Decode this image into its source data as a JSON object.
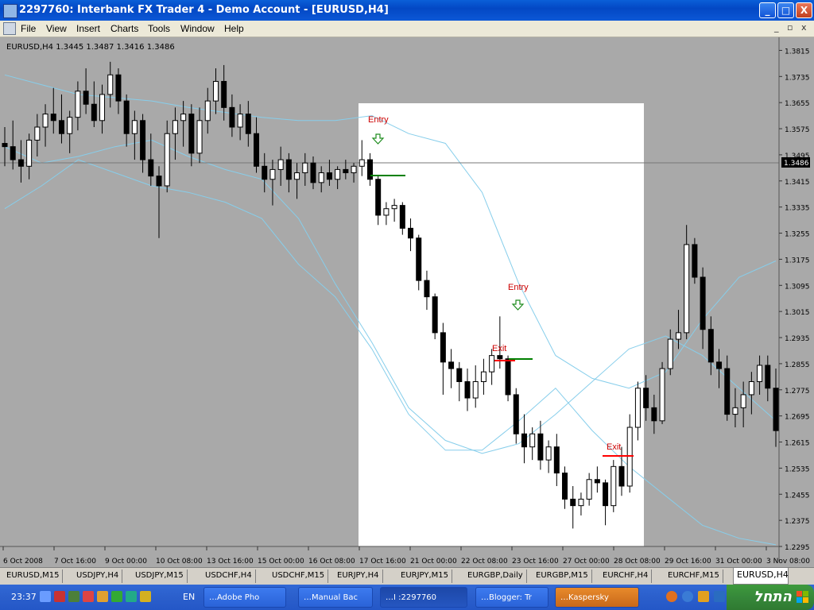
{
  "window": {
    "title": "2297760: Interbank FX Trader 4 - Demo Account - [EURUSD,H4]",
    "minimize": "_",
    "maximize": "□",
    "close": "X"
  },
  "menu": {
    "items": [
      "File",
      "View",
      "Insert",
      "Charts",
      "Tools",
      "Window",
      "Help"
    ],
    "mdi_controls": [
      "_",
      "▫",
      "x"
    ]
  },
  "chart": {
    "header": "EURUSD,H4  1.3445 1.3487 1.3416 1.3486",
    "current_price": "1.3486",
    "colors": {
      "background": "#a9a9a9",
      "panel": "#ffffff",
      "bands": "#87ceeb",
      "candle": "#000000",
      "entry_line": "#008000",
      "exit_line": "#ff0000",
      "annotation_text": "#cc0000",
      "arrow": "#1e8c1e"
    },
    "annotations": [
      {
        "text": "Entry"
      },
      {
        "text": "Entry"
      },
      {
        "text": "Exit"
      },
      {
        "text": "Exit"
      }
    ]
  },
  "chart_data": {
    "type": "candlestick",
    "symbol": "EURUSD",
    "timeframe": "H4",
    "ylim": [
      1.2295,
      1.3855
    ],
    "y_ticks": [
      "1.3815",
      "1.3735",
      "1.3655",
      "1.3575",
      "1.3495",
      "1.3415",
      "1.3335",
      "1.3255",
      "1.3175",
      "1.3095",
      "1.3015",
      "1.2935",
      "1.2855",
      "1.2775",
      "1.2695",
      "1.2615",
      "1.2535",
      "1.2455",
      "1.2375",
      "1.2295"
    ],
    "x_ticks": [
      "6 Oct 2008",
      "7 Oct 16:00",
      "9 Oct 00:00",
      "10 Oct 08:00",
      "13 Oct 16:00",
      "15 Oct 00:00",
      "16 Oct 08:00",
      "17 Oct 16:00",
      "21 Oct 00:00",
      "22 Oct 08:00",
      "23 Oct 16:00",
      "27 Oct 00:00",
      "28 Oct 08:00",
      "29 Oct 16:00",
      "31 Oct 00:00",
      "3 Nov 08:00"
    ],
    "last_price": 1.3486,
    "bollinger": {
      "upper": [
        1.374,
        1.371,
        1.368,
        1.367,
        1.366,
        1.364,
        1.3625,
        1.361,
        1.36,
        1.36,
        1.3615,
        1.356,
        1.353,
        1.338,
        1.31,
        1.288,
        1.281,
        1.278,
        1.283,
        1.299,
        1.312,
        1.317
      ],
      "middle": [
        1.352,
        1.347,
        1.349,
        1.352,
        1.354,
        1.349,
        1.345,
        1.342,
        1.33,
        1.31,
        1.292,
        1.272,
        1.262,
        1.258,
        1.261,
        1.27,
        1.28,
        1.29,
        1.294,
        1.288,
        1.278,
        1.268
      ],
      "lower": [
        1.333,
        1.34,
        1.348,
        1.344,
        1.34,
        1.338,
        1.335,
        1.33,
        1.316,
        1.306,
        1.29,
        1.27,
        1.259,
        1.259,
        1.268,
        1.278,
        1.265,
        1.254,
        1.245,
        1.236,
        1.232,
        1.23
      ]
    },
    "candles": [
      {
        "o": 1.353,
        "h": 1.358,
        "l": 1.346,
        "c": 1.352
      },
      {
        "o": 1.352,
        "h": 1.36,
        "l": 1.345,
        "c": 1.348
      },
      {
        "o": 1.348,
        "h": 1.354,
        "l": 1.341,
        "c": 1.346
      },
      {
        "o": 1.346,
        "h": 1.356,
        "l": 1.342,
        "c": 1.354
      },
      {
        "o": 1.354,
        "h": 1.362,
        "l": 1.349,
        "c": 1.358
      },
      {
        "o": 1.358,
        "h": 1.365,
        "l": 1.352,
        "c": 1.362
      },
      {
        "o": 1.362,
        "h": 1.37,
        "l": 1.356,
        "c": 1.36
      },
      {
        "o": 1.36,
        "h": 1.368,
        "l": 1.353,
        "c": 1.356
      },
      {
        "o": 1.356,
        "h": 1.363,
        "l": 1.35,
        "c": 1.361
      },
      {
        "o": 1.361,
        "h": 1.372,
        "l": 1.357,
        "c": 1.369
      },
      {
        "o": 1.369,
        "h": 1.376,
        "l": 1.362,
        "c": 1.365
      },
      {
        "o": 1.365,
        "h": 1.372,
        "l": 1.358,
        "c": 1.36
      },
      {
        "o": 1.36,
        "h": 1.371,
        "l": 1.356,
        "c": 1.368
      },
      {
        "o": 1.368,
        "h": 1.378,
        "l": 1.364,
        "c": 1.374
      },
      {
        "o": 1.374,
        "h": 1.376,
        "l": 1.362,
        "c": 1.366
      },
      {
        "o": 1.366,
        "h": 1.368,
        "l": 1.352,
        "c": 1.356
      },
      {
        "o": 1.356,
        "h": 1.363,
        "l": 1.348,
        "c": 1.36
      },
      {
        "o": 1.36,
        "h": 1.362,
        "l": 1.344,
        "c": 1.348
      },
      {
        "o": 1.348,
        "h": 1.356,
        "l": 1.34,
        "c": 1.343
      },
      {
        "o": 1.343,
        "h": 1.346,
        "l": 1.324,
        "c": 1.34
      },
      {
        "o": 1.34,
        "h": 1.36,
        "l": 1.338,
        "c": 1.356
      },
      {
        "o": 1.356,
        "h": 1.364,
        "l": 1.348,
        "c": 1.36
      },
      {
        "o": 1.36,
        "h": 1.366,
        "l": 1.352,
        "c": 1.362
      },
      {
        "o": 1.362,
        "h": 1.365,
        "l": 1.346,
        "c": 1.35
      },
      {
        "o": 1.35,
        "h": 1.364,
        "l": 1.347,
        "c": 1.36
      },
      {
        "o": 1.36,
        "h": 1.37,
        "l": 1.356,
        "c": 1.366
      },
      {
        "o": 1.366,
        "h": 1.376,
        "l": 1.362,
        "c": 1.372
      },
      {
        "o": 1.372,
        "h": 1.377,
        "l": 1.36,
        "c": 1.364
      },
      {
        "o": 1.364,
        "h": 1.368,
        "l": 1.355,
        "c": 1.358
      },
      {
        "o": 1.358,
        "h": 1.365,
        "l": 1.354,
        "c": 1.362
      },
      {
        "o": 1.362,
        "h": 1.366,
        "l": 1.352,
        "c": 1.356
      },
      {
        "o": 1.356,
        "h": 1.361,
        "l": 1.344,
        "c": 1.346
      },
      {
        "o": 1.346,
        "h": 1.35,
        "l": 1.338,
        "c": 1.342
      },
      {
        "o": 1.342,
        "h": 1.348,
        "l": 1.334,
        "c": 1.345
      },
      {
        "o": 1.345,
        "h": 1.352,
        "l": 1.34,
        "c": 1.348
      },
      {
        "o": 1.348,
        "h": 1.35,
        "l": 1.338,
        "c": 1.342
      },
      {
        "o": 1.342,
        "h": 1.347,
        "l": 1.336,
        "c": 1.344
      },
      {
        "o": 1.344,
        "h": 1.35,
        "l": 1.34,
        "c": 1.347
      },
      {
        "o": 1.347,
        "h": 1.349,
        "l": 1.339,
        "c": 1.341
      },
      {
        "o": 1.341,
        "h": 1.346,
        "l": 1.338,
        "c": 1.344
      },
      {
        "o": 1.344,
        "h": 1.348,
        "l": 1.34,
        "c": 1.342
      },
      {
        "o": 1.342,
        "h": 1.346,
        "l": 1.339,
        "c": 1.345
      },
      {
        "o": 1.345,
        "h": 1.348,
        "l": 1.342,
        "c": 1.344
      },
      {
        "o": 1.344,
        "h": 1.347,
        "l": 1.341,
        "c": 1.346
      },
      {
        "o": 1.346,
        "h": 1.354,
        "l": 1.343,
        "c": 1.348
      },
      {
        "o": 1.348,
        "h": 1.35,
        "l": 1.34,
        "c": 1.342
      },
      {
        "o": 1.342,
        "h": 1.343,
        "l": 1.328,
        "c": 1.331
      },
      {
        "o": 1.331,
        "h": 1.335,
        "l": 1.328,
        "c": 1.333
      },
      {
        "o": 1.333,
        "h": 1.336,
        "l": 1.329,
        "c": 1.334
      },
      {
        "o": 1.334,
        "h": 1.335,
        "l": 1.325,
        "c": 1.327
      },
      {
        "o": 1.327,
        "h": 1.33,
        "l": 1.32,
        "c": 1.324
      },
      {
        "o": 1.324,
        "h": 1.325,
        "l": 1.308,
        "c": 1.311
      },
      {
        "o": 1.311,
        "h": 1.314,
        "l": 1.302,
        "c": 1.306
      },
      {
        "o": 1.306,
        "h": 1.307,
        "l": 1.293,
        "c": 1.295
      },
      {
        "o": 1.295,
        "h": 1.298,
        "l": 1.276,
        "c": 1.286
      },
      {
        "o": 1.286,
        "h": 1.29,
        "l": 1.278,
        "c": 1.284
      },
      {
        "o": 1.284,
        "h": 1.286,
        "l": 1.274,
        "c": 1.28
      },
      {
        "o": 1.28,
        "h": 1.284,
        "l": 1.271,
        "c": 1.275
      },
      {
        "o": 1.275,
        "h": 1.285,
        "l": 1.272,
        "c": 1.28
      },
      {
        "o": 1.28,
        "h": 1.287,
        "l": 1.276,
        "c": 1.283
      },
      {
        "o": 1.283,
        "h": 1.29,
        "l": 1.279,
        "c": 1.288
      },
      {
        "o": 1.288,
        "h": 1.3,
        "l": 1.284,
        "c": 1.287
      },
      {
        "o": 1.287,
        "h": 1.288,
        "l": 1.274,
        "c": 1.276
      },
      {
        "o": 1.276,
        "h": 1.278,
        "l": 1.261,
        "c": 1.264
      },
      {
        "o": 1.264,
        "h": 1.27,
        "l": 1.255,
        "c": 1.26
      },
      {
        "o": 1.26,
        "h": 1.266,
        "l": 1.256,
        "c": 1.264
      },
      {
        "o": 1.264,
        "h": 1.268,
        "l": 1.253,
        "c": 1.256
      },
      {
        "o": 1.256,
        "h": 1.262,
        "l": 1.252,
        "c": 1.26
      },
      {
        "o": 1.26,
        "h": 1.264,
        "l": 1.248,
        "c": 1.252
      },
      {
        "o": 1.252,
        "h": 1.254,
        "l": 1.241,
        "c": 1.244
      },
      {
        "o": 1.244,
        "h": 1.248,
        "l": 1.235,
        "c": 1.242
      },
      {
        "o": 1.242,
        "h": 1.246,
        "l": 1.239,
        "c": 1.244
      },
      {
        "o": 1.244,
        "h": 1.252,
        "l": 1.242,
        "c": 1.25
      },
      {
        "o": 1.25,
        "h": 1.254,
        "l": 1.246,
        "c": 1.249
      },
      {
        "o": 1.249,
        "h": 1.25,
        "l": 1.236,
        "c": 1.242
      },
      {
        "o": 1.242,
        "h": 1.256,
        "l": 1.24,
        "c": 1.254
      },
      {
        "o": 1.254,
        "h": 1.26,
        "l": 1.245,
        "c": 1.248
      },
      {
        "o": 1.248,
        "h": 1.27,
        "l": 1.246,
        "c": 1.266
      },
      {
        "o": 1.266,
        "h": 1.28,
        "l": 1.262,
        "c": 1.278
      },
      {
        "o": 1.278,
        "h": 1.282,
        "l": 1.268,
        "c": 1.272
      },
      {
        "o": 1.272,
        "h": 1.276,
        "l": 1.264,
        "c": 1.268
      },
      {
        "o": 1.268,
        "h": 1.286,
        "l": 1.267,
        "c": 1.284
      },
      {
        "o": 1.284,
        "h": 1.296,
        "l": 1.282,
        "c": 1.293
      },
      {
        "o": 1.293,
        "h": 1.302,
        "l": 1.29,
        "c": 1.295
      },
      {
        "o": 1.295,
        "h": 1.328,
        "l": 1.293,
        "c": 1.322
      },
      {
        "o": 1.322,
        "h": 1.324,
        "l": 1.31,
        "c": 1.312
      },
      {
        "o": 1.312,
        "h": 1.315,
        "l": 1.29,
        "c": 1.296
      },
      {
        "o": 1.296,
        "h": 1.3,
        "l": 1.282,
        "c": 1.286
      },
      {
        "o": 1.286,
        "h": 1.29,
        "l": 1.278,
        "c": 1.284
      },
      {
        "o": 1.284,
        "h": 1.288,
        "l": 1.268,
        "c": 1.27
      },
      {
        "o": 1.27,
        "h": 1.278,
        "l": 1.266,
        "c": 1.272
      },
      {
        "o": 1.272,
        "h": 1.28,
        "l": 1.266,
        "c": 1.276
      },
      {
        "o": 1.276,
        "h": 1.283,
        "l": 1.27,
        "c": 1.28
      },
      {
        "o": 1.28,
        "h": 1.288,
        "l": 1.276,
        "c": 1.285
      },
      {
        "o": 1.285,
        "h": 1.288,
        "l": 1.274,
        "c": 1.278
      },
      {
        "o": 1.278,
        "h": 1.284,
        "l": 1.26,
        "c": 1.265
      }
    ]
  },
  "tabs": [
    "EURUSD,M15",
    "USDJPY,H4",
    "USDJPY,M15",
    "USDCHF,H4",
    "USDCHF,M15",
    "EURJPY,H4",
    "EURJPY,M15",
    "EURGBP,Daily",
    "EURGBP,M15",
    "EURCHF,H4",
    "EURCHF,M15",
    "EURUSD,H4"
  ],
  "active_tab": "EURUSD,H4",
  "taskbar": {
    "clock": "23:37",
    "lang": "EN",
    "start_label": "התחל",
    "tasks": [
      {
        "label": "Adobe Pho",
        "icon": "photoshop-icon"
      },
      {
        "label": "Manual Bac",
        "icon": "folder-icon"
      },
      {
        "label": "I :2297760",
        "icon": "mt4-icon"
      },
      {
        "label": "Blogger: Tr",
        "icon": "firefox-icon"
      },
      {
        "label": "Kaspersky",
        "icon": "kaspersky-icon"
      }
    ],
    "quicklaunch": [
      "firefox-icon",
      "ie-icon",
      "media-icon",
      "arrow-icon"
    ]
  }
}
